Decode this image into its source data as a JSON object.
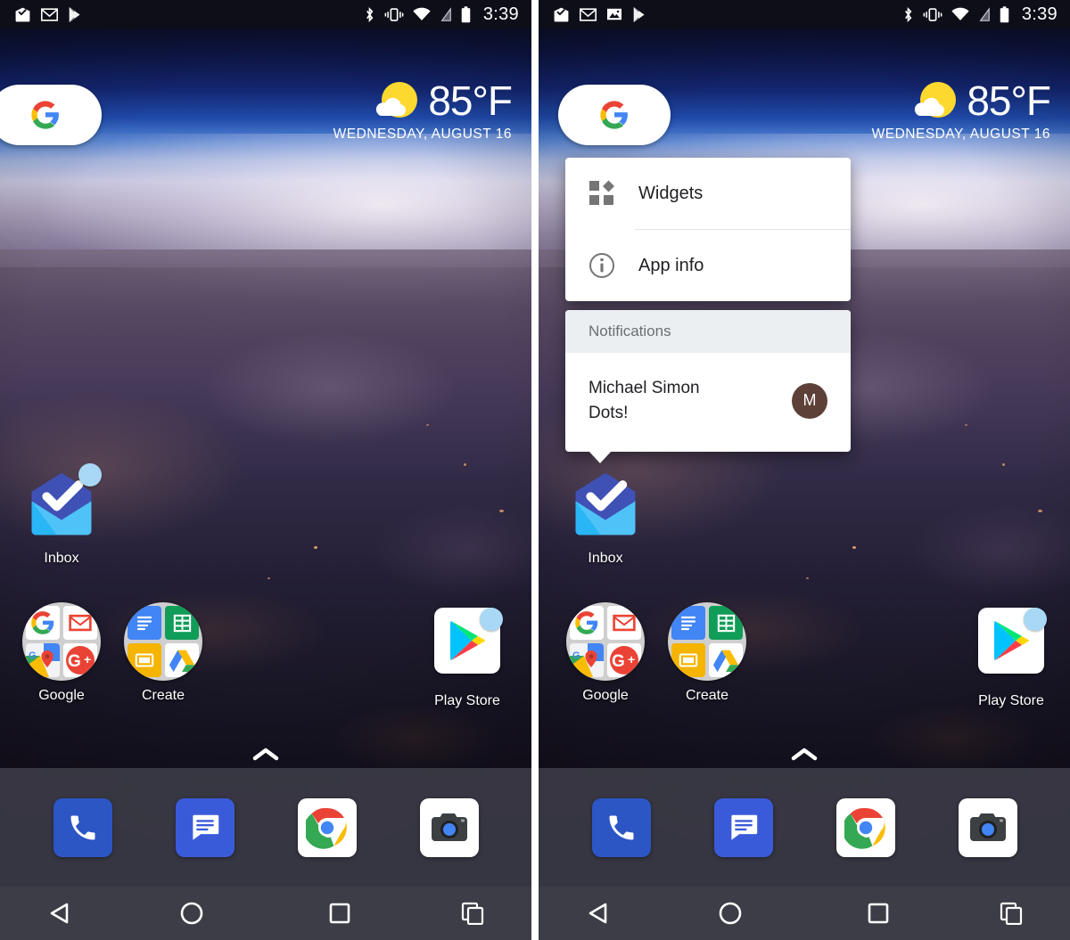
{
  "statusbar": {
    "left_icons_left_panel": [
      "inbox-icon",
      "gmail-icon",
      "play-store-icon"
    ],
    "left_icons_right_panel": [
      "inbox-icon",
      "gmail-icon",
      "photos-icon",
      "play-store-icon"
    ],
    "right_icons": [
      "bluetooth-icon",
      "vibrate-icon",
      "wifi-icon",
      "signal-off-icon",
      "battery-icon"
    ],
    "time": "3:39"
  },
  "widget": {
    "search_logo": "google-g-logo",
    "weather_icon": "partly-cloudy-icon",
    "temperature": "85°F",
    "date": "WEDNESDAY, AUGUST 16"
  },
  "home": {
    "inbox": {
      "label": "Inbox",
      "has_dot": true
    },
    "google_folder": {
      "label": "Google",
      "apps": [
        "google-search-icon",
        "gmail-icon",
        "google-maps-icon",
        "google-plus-icon"
      ]
    },
    "create_folder": {
      "label": "Create",
      "apps": [
        "google-docs-icon",
        "google-sheets-icon",
        "google-slides-icon",
        "google-drive-icon"
      ]
    },
    "play_store": {
      "label": "Play Store",
      "has_dot": true
    },
    "app_drawer_handle": "chevron-up-icon"
  },
  "dock": {
    "items": [
      {
        "name": "phone-icon",
        "label": "Phone"
      },
      {
        "name": "messages-icon",
        "label": "Messages"
      },
      {
        "name": "chrome-icon",
        "label": "Chrome"
      },
      {
        "name": "camera-icon",
        "label": "Camera"
      }
    ]
  },
  "navbar": {
    "back": "back-triangle-icon",
    "home": "home-circle-icon",
    "recents": "recents-square-icon",
    "split": "split-screen-icon"
  },
  "popup": {
    "menu": [
      {
        "label": "Widgets",
        "icon": "widgets-icon"
      },
      {
        "label": "App info",
        "icon": "info-icon"
      }
    ],
    "notifications_header": "Notifications",
    "notification": {
      "title": "Michael Simon",
      "body": "Dots!",
      "avatar_initial": "M"
    }
  },
  "colors": {
    "accent_blue": "#4285f4",
    "badge_dot": "#a8d8f5",
    "avatar_brown": "#5d4037",
    "dock_bg": "#3a3a46",
    "navbar_bg": "#3d3d47",
    "statusbar_bg": "#0d0e18"
  }
}
